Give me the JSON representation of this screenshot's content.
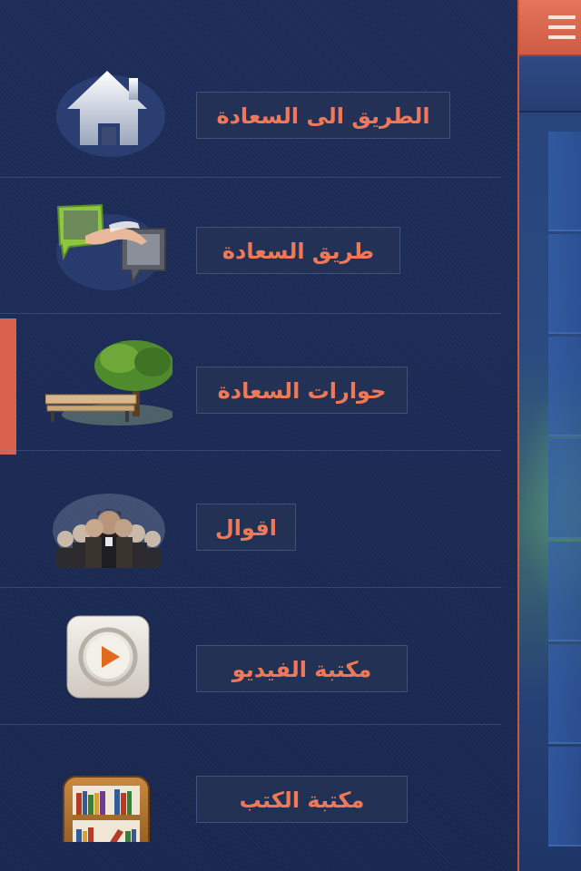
{
  "menu": {
    "items": [
      {
        "label": "الطريق الى السعادة",
        "icon": "home-icon"
      },
      {
        "label": "طريق السعادة",
        "icon": "handshake-chat-icon"
      },
      {
        "label": "حوارات السعادة",
        "icon": "tree-bench-icon"
      },
      {
        "label": "اقوال",
        "icon": "famous-people-icon"
      },
      {
        "label": "مكتبة الفيديو",
        "icon": "video-play-icon"
      },
      {
        "label": "مكتبة الكتب",
        "icon": "bookshelf-icon"
      }
    ],
    "active_index": 2
  },
  "topbar": {
    "menu_icon": "hamburger-icon"
  },
  "colors": {
    "accent": "#d8624d",
    "label_text": "#ee7858",
    "background": "#1c2b55"
  }
}
